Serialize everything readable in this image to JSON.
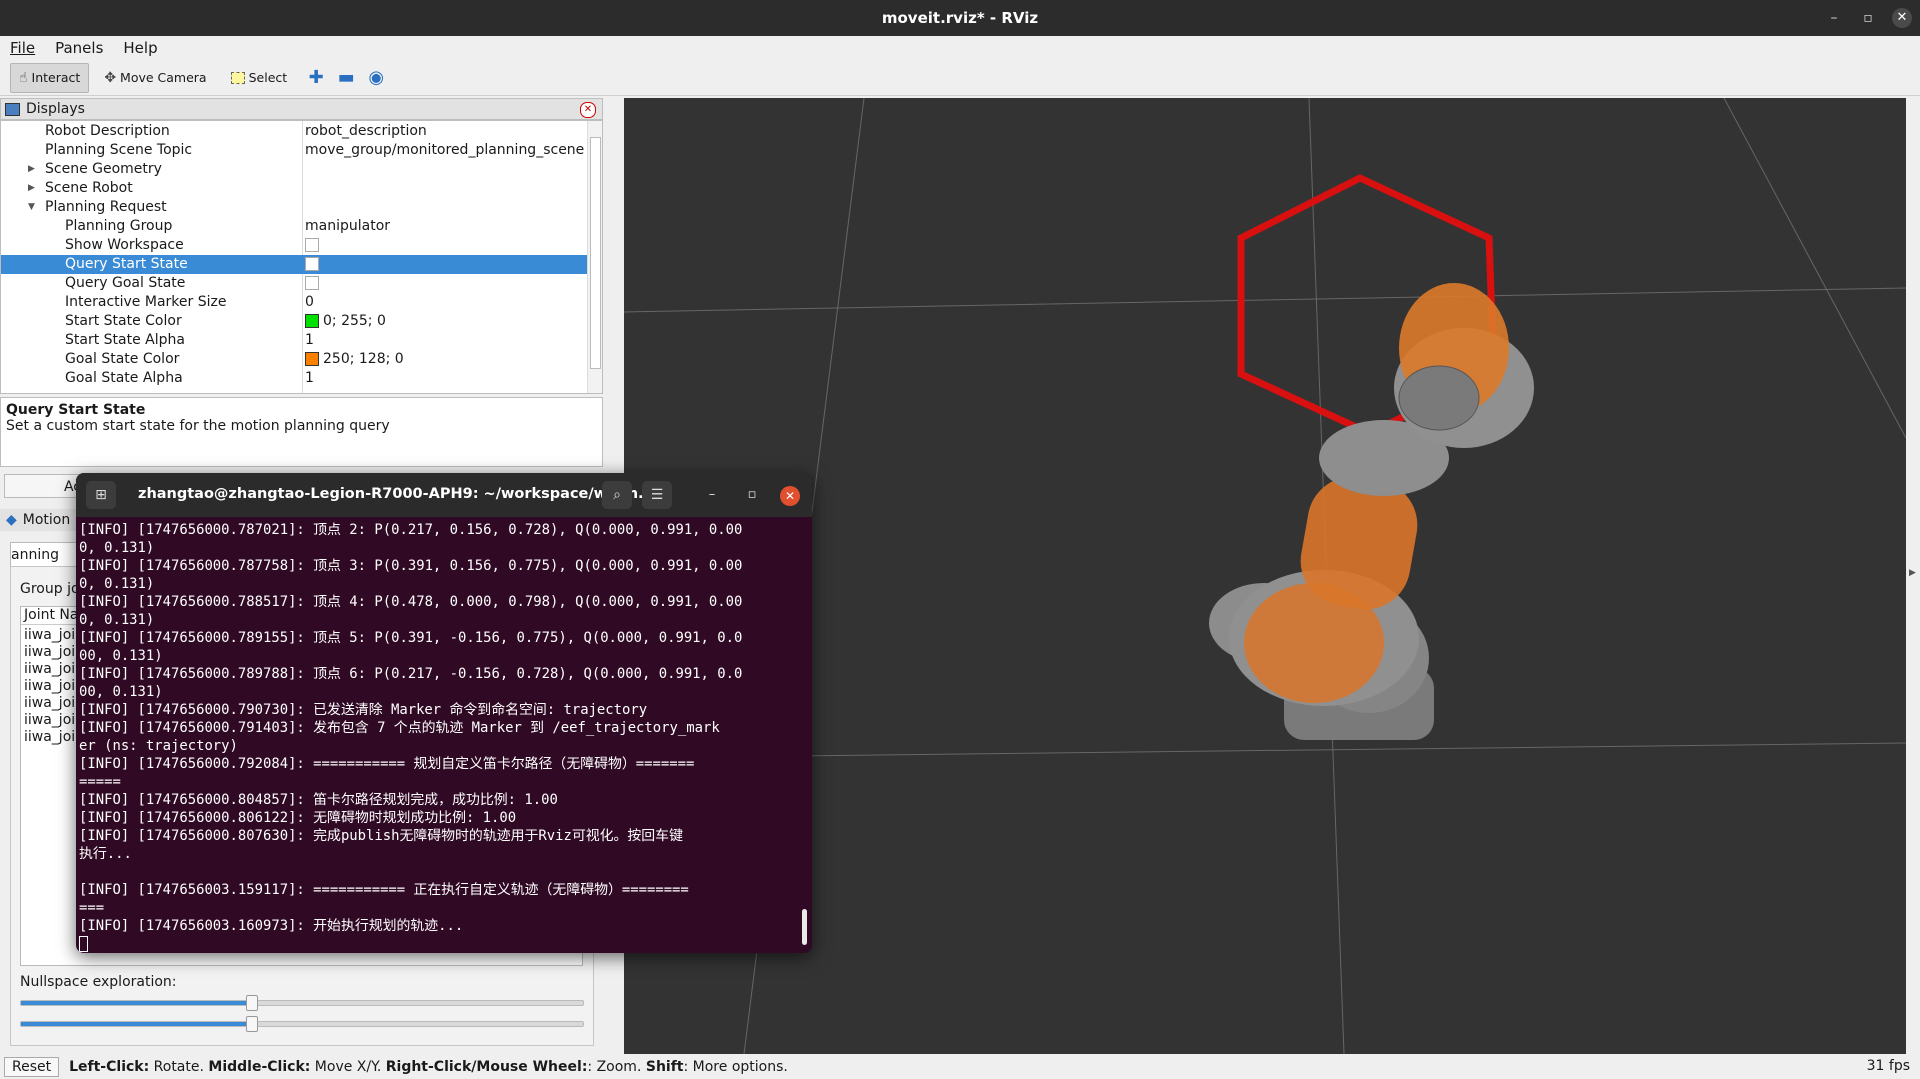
{
  "window": {
    "title": "moveit.rviz* - RViz",
    "minimize_icon": "minimize-icon",
    "maximize_icon": "maximize-icon",
    "close_icon": "close-icon"
  },
  "menu": [
    "File",
    "Panels",
    "Help"
  ],
  "toolbar": {
    "interact": "Interact",
    "move_camera": "Move Camera",
    "select": "Select",
    "add_icon": "plus-icon",
    "remove_icon": "minus-icon",
    "view_icon": "eye-icon"
  },
  "displays": {
    "title": "Displays",
    "rows": [
      {
        "key": "Robot Description",
        "value": "robot_description"
      },
      {
        "key": "Planning Scene Topic",
        "value": "move_group/monitored_planning_scene"
      },
      {
        "key": "Scene Geometry",
        "value": ""
      },
      {
        "key": "Scene Robot",
        "value": ""
      },
      {
        "key": "Planning Request",
        "value": ""
      },
      {
        "key": "Planning Group",
        "value": "manipulator"
      },
      {
        "key": "Show Workspace",
        "value": ""
      },
      {
        "key": "Query Start State",
        "value": ""
      },
      {
        "key": "Query Goal State",
        "value": ""
      },
      {
        "key": "Interactive Marker Size",
        "value": "0"
      },
      {
        "key": "Start State Color",
        "value": "0; 255; 0"
      },
      {
        "key": "Start State Alpha",
        "value": "1"
      },
      {
        "key": "Goal State Color",
        "value": "250; 128; 0"
      },
      {
        "key": "Goal State Alpha",
        "value": "1"
      }
    ],
    "start_color": "#00ff00",
    "goal_color": "#fa8000",
    "description_title": "Query Start State",
    "description_text": "Set a custom start state for the motion planning query"
  },
  "motion": {
    "add_label": "Ac",
    "header": "Motion",
    "tab": "anning",
    "group_label": "Group jo",
    "list_header": "Joint Na",
    "joints": [
      "iiwa_joi",
      "iiwa_joi",
      "iiwa_joi",
      "iiwa_joi",
      "iiwa_joi",
      "iiwa_joi",
      "iiwa_joi"
    ],
    "nullspace_label": "Nullspace exploration:",
    "slider1_level": 0.41,
    "slider2_level": 0.41
  },
  "terminal": {
    "title": "zhangtao@zhangtao-Legion-R7000-APH9: ~/workspace/ws_m...",
    "lines": [
      "[INFO] [1747656000.787021]: 顶点 2: P(0.217, 0.156, 0.728), Q(0.000, 0.991, 0.00",
      "0, 0.131)",
      "[INFO] [1747656000.787758]: 顶点 3: P(0.391, 0.156, 0.775), Q(0.000, 0.991, 0.00",
      "0, 0.131)",
      "[INFO] [1747656000.788517]: 顶点 4: P(0.478, 0.000, 0.798), Q(0.000, 0.991, 0.00",
      "0, 0.131)",
      "[INFO] [1747656000.789155]: 顶点 5: P(0.391, -0.156, 0.775), Q(0.000, 0.991, 0.0",
      "00, 0.131)",
      "[INFO] [1747656000.789788]: 顶点 6: P(0.217, -0.156, 0.728), Q(0.000, 0.991, 0.0",
      "00, 0.131)",
      "[INFO] [1747656000.790730]: 已发送清除 Marker 命令到命名空间: trajectory",
      "[INFO] [1747656000.791403]: 发布包含 7 个点的轨迹 Marker 到 /eef_trajectory_mark",
      "er (ns: trajectory)",
      "[INFO] [1747656000.792084]: =========== 规划自定义笛卡尔路径（无障碍物）=======",
      "=====",
      "[INFO] [1747656000.804857]: 笛卡尔路径规划完成，成功比例: 1.00",
      "[INFO] [1747656000.806122]: 无障碍物时规划成功比例: 1.00",
      "[INFO] [1747656000.807630]: 完成publish无障碍物时的轨迹用于Rviz可视化。按回车键",
      "执行...",
      "",
      "[INFO] [1747656003.159117]: =========== 正在执行自定义轨迹（无障碍物）========",
      "===",
      "[INFO] [1747656003.160973]: 开始执行规划的轨迹..."
    ]
  },
  "status": {
    "reset": "Reset",
    "left_click": "Left-Click:",
    "left_click_action": " Rotate. ",
    "middle_click": "Middle-Click:",
    "middle_click_action": " Move X/Y. ",
    "right_click": "Right-Click/Mouse Wheel:",
    "right_click_action": ": Zoom. ",
    "shift": "Shift",
    "shift_action": ": More options.",
    "fps": "31 fps"
  },
  "colors": {
    "selection": "#3a8bd6",
    "terminal_bg": "#300a24",
    "marker_red": "#e01010",
    "robot_orange": "#e07020"
  }
}
